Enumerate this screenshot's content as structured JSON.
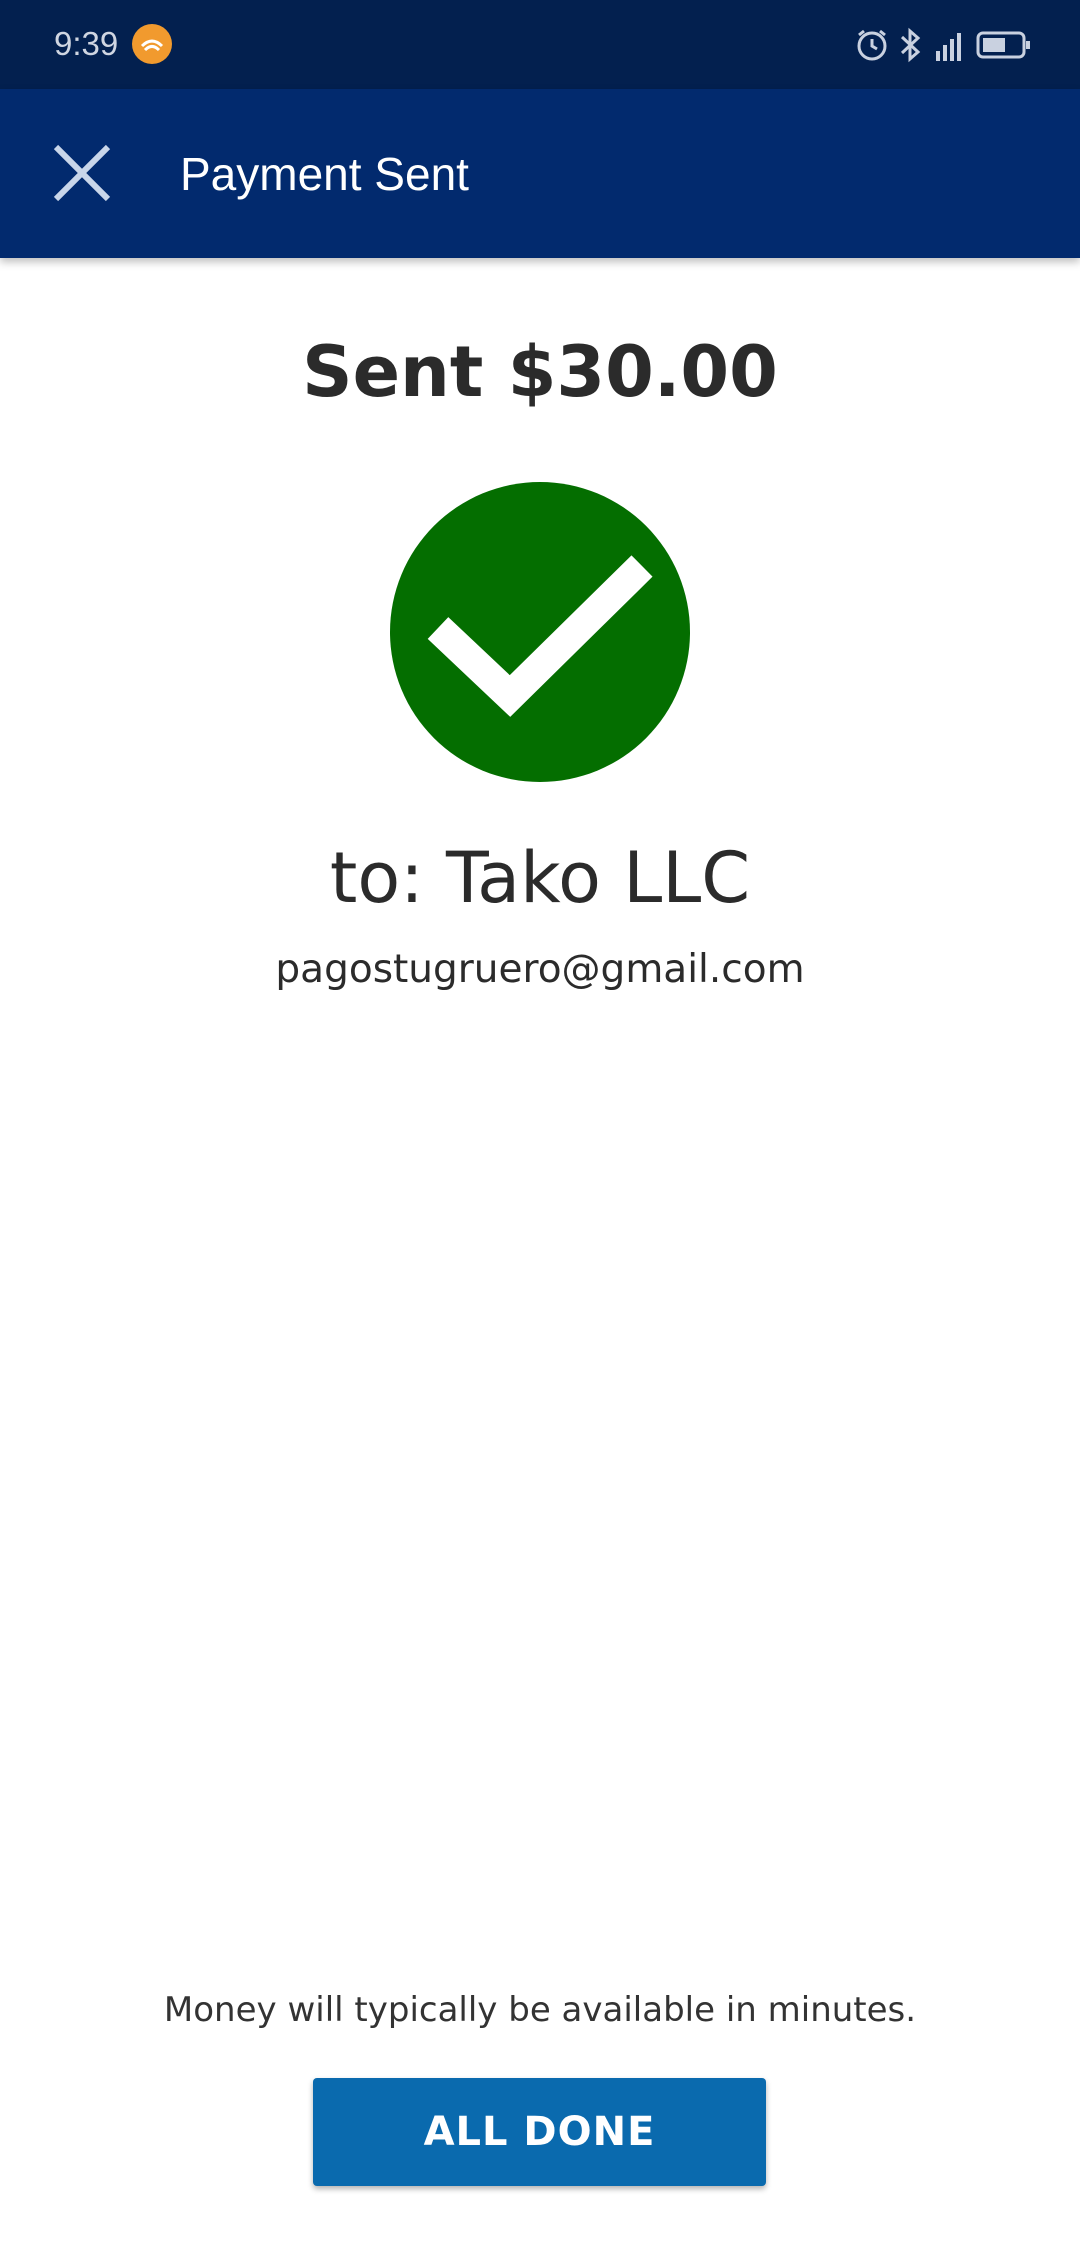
{
  "status_bar": {
    "time": "9:39",
    "icons": [
      "notification-app-icon",
      "alarm-icon",
      "bluetooth-icon",
      "signal-icon",
      "battery-icon"
    ],
    "background": "#03204f"
  },
  "app_bar": {
    "title": "Payment Sent",
    "close_icon": "close-icon",
    "background": "#022a6e"
  },
  "confirmation": {
    "amount_text": "Sent $30.00",
    "status_icon": "checkmark-icon",
    "status_color": "#046e00",
    "recipient_name": "to: Tako LLC",
    "recipient_email": "pagostugruero@gmail.com"
  },
  "footer": {
    "note": "Money will typically be available in minutes.",
    "done_label": "ALL DONE",
    "button_color": "#0a6aae"
  }
}
